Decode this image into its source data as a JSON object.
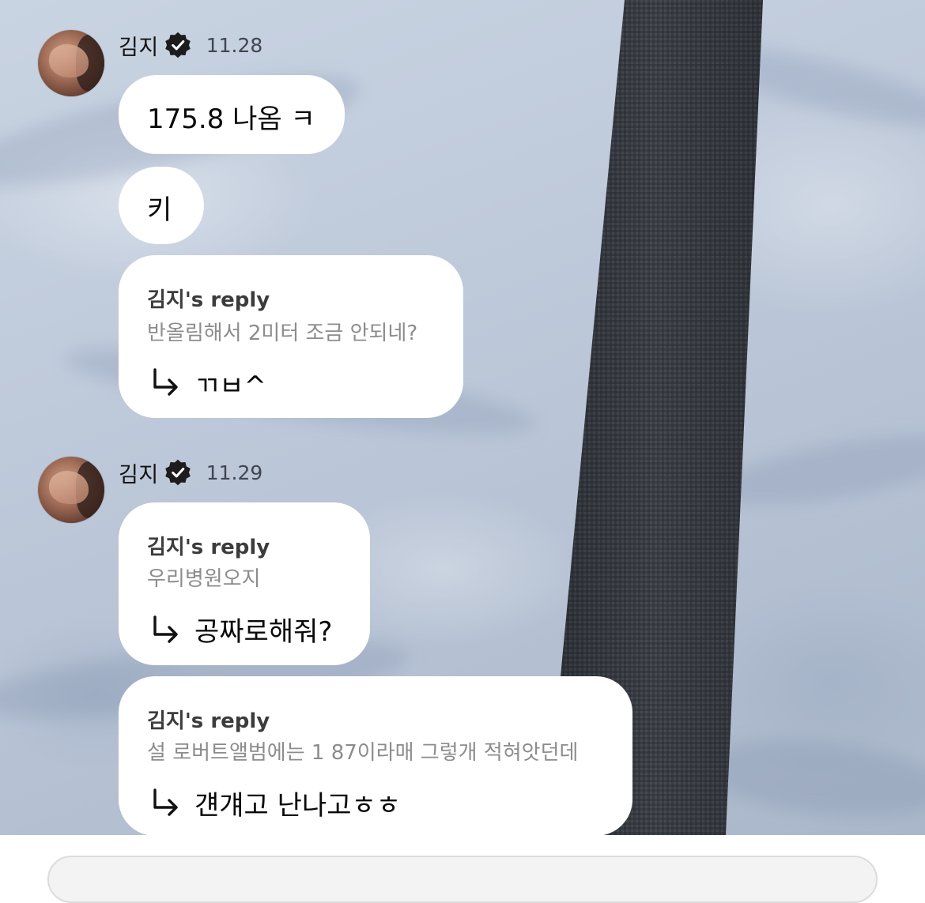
{
  "chat": {
    "messages": [
      {
        "sender": "김지",
        "time": "11.28",
        "bubbles": [
          "175.8 나옴 ㅋ",
          "키"
        ],
        "replies": [
          {
            "label": "김지's reply",
            "quote": "반올림해서 2미터 조금 안되네?",
            "text": "ㄲㅂ^"
          }
        ]
      },
      {
        "sender": "김지",
        "time": "11.29",
        "bubbles": [],
        "replies": [
          {
            "label": "김지's reply",
            "quote": "우리병원오지",
            "text": "공짜로해줘?"
          },
          {
            "label": "김지's reply",
            "quote": "설 로버트앨범에는 1 87이라매 그렇개 적혀앗던데",
            "text": "걘걔고 난나고ㅎㅎ"
          }
        ]
      }
    ]
  },
  "icons": {
    "verified": "verified-badge-icon",
    "reply_arrow": "reply-arrow-icon",
    "avatar": "avatar"
  },
  "colors": {
    "bubble_bg": "#ffffff",
    "reply_label": "#3c3c3c",
    "reply_quote": "#8c8c8c",
    "seatbelt": "#3a3e45"
  }
}
